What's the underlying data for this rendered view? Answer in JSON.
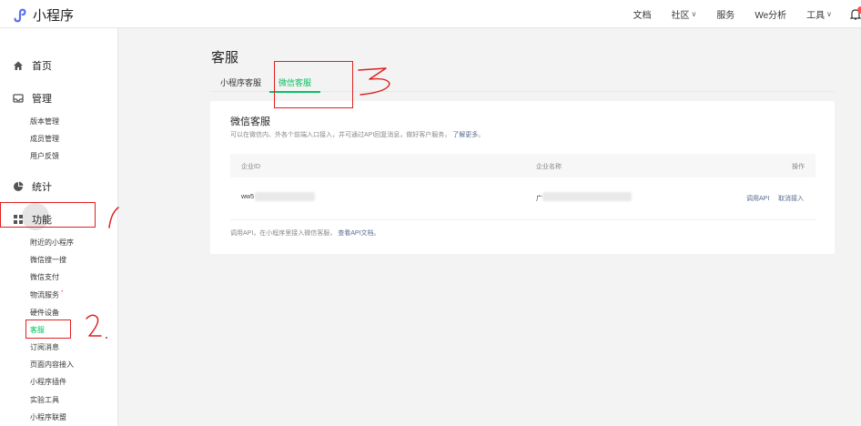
{
  "app": {
    "logo_text": "小程序"
  },
  "topnav": {
    "items": [
      {
        "label": "文档",
        "has_menu": false
      },
      {
        "label": "社区",
        "has_menu": true
      },
      {
        "label": "服务",
        "has_menu": false
      },
      {
        "label": "We分析",
        "has_menu": false
      },
      {
        "label": "工具",
        "has_menu": true
      }
    ],
    "caret": "∨",
    "notification_icon": "bell-icon"
  },
  "sidebar": {
    "home": "首页",
    "manage": "管理",
    "manage_items": [
      "版本管理",
      "成员管理",
      "用户反馈"
    ],
    "stats": "统计",
    "features": "功能",
    "feature_items": [
      "附近的小程序",
      "微信搜一搜",
      "微信支付",
      "物流服务",
      "硬件设备",
      "客服",
      "订阅消息",
      "页面内容接入",
      "小程序插件",
      "实验工具",
      "小程序联盟"
    ],
    "required_mark": "*"
  },
  "main": {
    "title": "客服",
    "tabs": [
      "小程序客服",
      "微信客服"
    ],
    "card": {
      "title": "微信客服",
      "desc": "可以在微信内、外各个前端入口接入，并可通过API回复消息，做好客户服务，",
      "desc_link": "了解更多",
      "desc_end": "。",
      "columns": [
        "企业ID",
        "企业名称",
        "操作"
      ],
      "row": {
        "corp_id": "ww5",
        "corp_name": "广",
        "action_api": "调用API",
        "action_cancel": "取消接入"
      },
      "footer": "调用API，在小程序里接入微信客服，",
      "footer_link": "查看API文档",
      "footer_end": "。"
    }
  },
  "colors": {
    "accent": "#07c160",
    "link": "#576b95",
    "annotation": "#e02020"
  }
}
